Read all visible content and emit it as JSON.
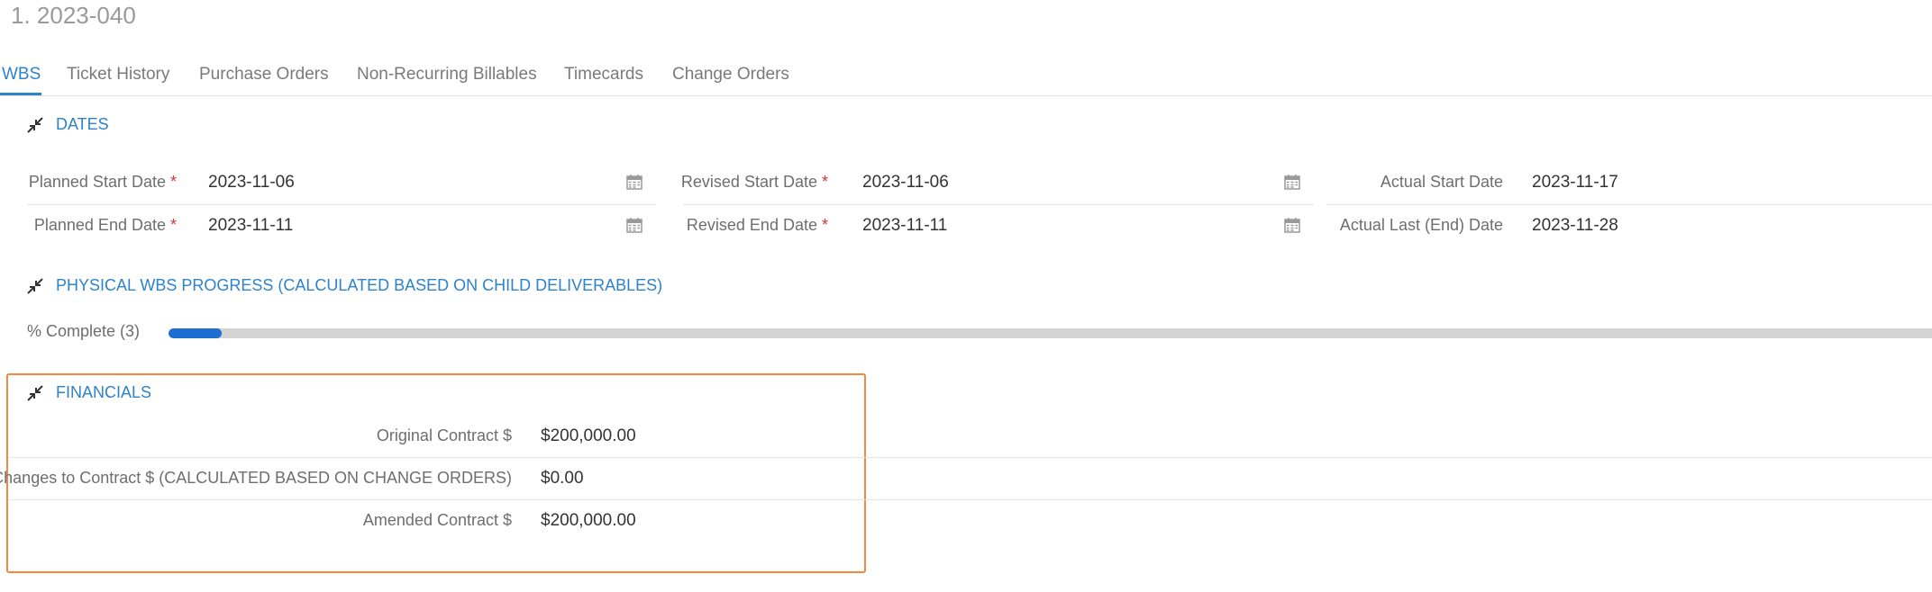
{
  "page": {
    "title": "1. 2023-040"
  },
  "tabs": [
    {
      "label": "WBS",
      "active": true
    },
    {
      "label": "Ticket History"
    },
    {
      "label": "Purchase Orders"
    },
    {
      "label": "Non-Recurring Billables"
    },
    {
      "label": "Timecards"
    },
    {
      "label": "Change Orders"
    }
  ],
  "dates": {
    "title": "DATES",
    "planned_start": {
      "label": "Planned Start Date",
      "value": "2023-11-06",
      "required": "*"
    },
    "planned_end": {
      "label": "Planned End Date",
      "value": "2023-11-11",
      "required": "*"
    },
    "revised_start": {
      "label": "Revised Start Date",
      "value": "2023-11-06",
      "required": "*"
    },
    "revised_end": {
      "label": "Revised End Date",
      "value": "2023-11-11",
      "required": "*"
    },
    "actual_start": {
      "label": "Actual Start Date",
      "value": "2023-11-17"
    },
    "actual_end": {
      "label": "Actual Last (End) Date",
      "value": "2023-11-28"
    }
  },
  "progress": {
    "title": "PHYSICAL WBS PROGRESS (CALCULATED BASED ON CHILD DELIVERABLES)",
    "label": "% Complete (3)",
    "percent": 3
  },
  "financials": {
    "title": "FINANCIALS",
    "original": {
      "label": "Original Contract $",
      "value": "$200,000.00"
    },
    "changes": {
      "label": "Changes to Contract $ (CALCULATED BASED ON CHANGE ORDERS)",
      "value": "$0.00"
    },
    "amended": {
      "label": "Amended Contract $",
      "value": "$200,000.00"
    }
  },
  "colors": {
    "accent": "#2f83c9",
    "required": "#d9312c",
    "progress": "#1c6fd1",
    "highlight": "#ef8a45"
  },
  "icons": {
    "collapse": "collapse-arrows-icon",
    "calendar": "calendar-icon"
  }
}
